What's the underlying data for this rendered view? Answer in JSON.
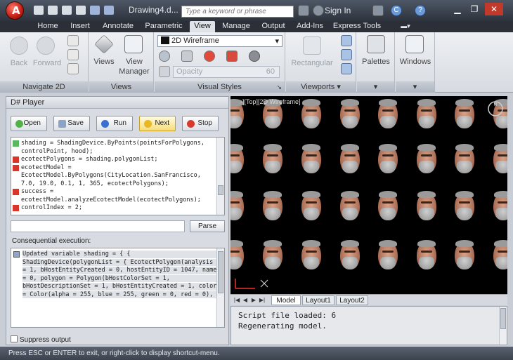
{
  "titlebar": {
    "doc_title": "Drawing4.d...",
    "search_placeholder": "Type a keyword or phrase",
    "sign_in": "Sign In",
    "help": "?"
  },
  "tabs": [
    "Home",
    "Insert",
    "Annotate",
    "Parametric",
    "View",
    "Manage",
    "Output",
    "Add-Ins",
    "Express Tools"
  ],
  "active_tab": "View",
  "ribbon": {
    "navigate": {
      "back": "Back",
      "forward": "Forward",
      "title": "Navigate 2D"
    },
    "views": {
      "views": "Views",
      "view_manager_1": "View",
      "view_manager_2": "Manager",
      "title": "Views"
    },
    "visual_styles": {
      "dropdown": "2D Wireframe",
      "opacity_label": "Opacity",
      "opacity_value": "60",
      "title": "Visual Styles"
    },
    "viewports": {
      "rectangular": "Rectangular",
      "title": "Viewports"
    },
    "palettes": {
      "label": "Palettes"
    },
    "windows": {
      "label": "Windows"
    }
  },
  "player": {
    "title": "D# Player",
    "buttons": {
      "open": "Open",
      "save": "Save",
      "run": "Run",
      "next": "Next",
      "stop": "Stop"
    },
    "code_lines": [
      {
        "text": "shading = ShadingDevice.ByPoints(pointsForPolygons,",
        "marker": "green"
      },
      {
        "text": "controlPoint, hood);",
        "marker": ""
      },
      {
        "text": "ecotectPolygons = shading.polygonList;",
        "marker": "red"
      },
      {
        "text": "ecotectModel =",
        "marker": "red"
      },
      {
        "text": "EcotectModel.ByPolygons(CityLocation.SanFrancisco,",
        "marker": ""
      },
      {
        "text": "7.0, 19.0, 0.1, 1, 365, ecotectPolygons);",
        "marker": ""
      },
      {
        "text": "success =",
        "marker": "red"
      },
      {
        "text": "ecotectModel.analyzeEcotectModel(ecotectPolygons);",
        "marker": ""
      },
      {
        "text": "controlIndex = 2;",
        "marker": "red"
      }
    ],
    "parse": "Parse",
    "consequential_label": "Consequential execution:",
    "output_lines": [
      "Updated variable shading = { {",
      "ShadingDevice(polygonList = { EcotectPolygon(analysis",
      "= 1, bHostEntityCreated = 0, hostEntityID = 1047, name",
      "= 0, polygon = Polygon(bHostColorSet = 1,",
      "bHostDescriptionSet = 1, bHostEntityCreated = 1, color",
      "= Color(alpha = 255, blue = 255, green = 0, red = 0),"
    ],
    "suppress": "Suppress output"
  },
  "viewport": {
    "label": "-][Top][2D Wireframe]"
  },
  "layout_tabs": [
    "Model",
    "Layout1",
    "Layout2"
  ],
  "command_window": {
    "lines": [
      "Script file loaded: 6",
      "Regenerating model."
    ]
  },
  "status_bar": "Press ESC or ENTER to exit, or right-click to display shortcut-menu."
}
